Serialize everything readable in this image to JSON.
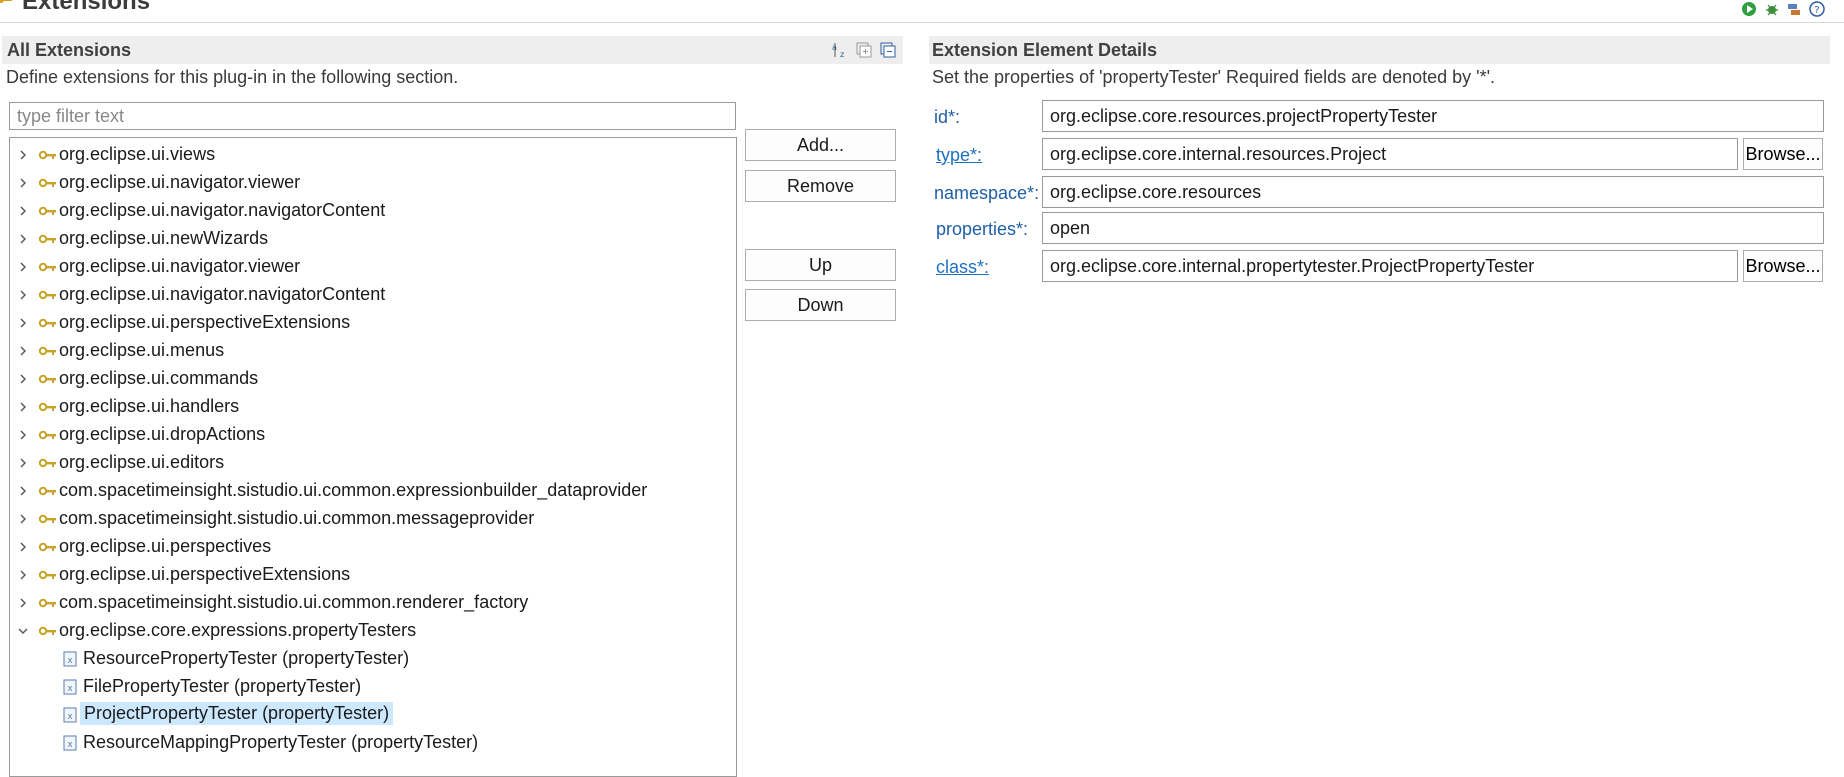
{
  "header": {
    "title": "Extensions",
    "icons": [
      "run-icon",
      "debug-icon",
      "plugin-icon",
      "help-icon"
    ]
  },
  "all_extensions": {
    "title": "All Extensions",
    "description": "Define extensions for this plug-in in the following section.",
    "toolbar_icons": [
      "sort-alpha-icon",
      "expand-all-icon",
      "collapse-all-icon"
    ],
    "filter_placeholder": "type filter text",
    "buttons": {
      "add": "Add...",
      "remove": "Remove",
      "up": "Up",
      "down": "Down"
    },
    "tree": [
      {
        "label": "org.eclipse.ui.views",
        "expanded": false
      },
      {
        "label": "org.eclipse.ui.navigator.viewer",
        "expanded": false
      },
      {
        "label": "org.eclipse.ui.navigator.navigatorContent",
        "expanded": false
      },
      {
        "label": "org.eclipse.ui.newWizards",
        "expanded": false
      },
      {
        "label": "org.eclipse.ui.navigator.viewer",
        "expanded": false
      },
      {
        "label": "org.eclipse.ui.navigator.navigatorContent",
        "expanded": false
      },
      {
        "label": "org.eclipse.ui.perspectiveExtensions",
        "expanded": false
      },
      {
        "label": "org.eclipse.ui.menus",
        "expanded": false
      },
      {
        "label": "org.eclipse.ui.commands",
        "expanded": false
      },
      {
        "label": "org.eclipse.ui.handlers",
        "expanded": false
      },
      {
        "label": "org.eclipse.ui.dropActions",
        "expanded": false
      },
      {
        "label": "org.eclipse.ui.editors",
        "expanded": false
      },
      {
        "label": "com.spacetimeinsight.sistudio.ui.common.expressionbuilder_dataprovider",
        "expanded": false
      },
      {
        "label": "com.spacetimeinsight.sistudio.ui.common.messageprovider",
        "expanded": false
      },
      {
        "label": "org.eclipse.ui.perspectives",
        "expanded": false
      },
      {
        "label": "org.eclipse.ui.perspectiveExtensions",
        "expanded": false
      },
      {
        "label": "com.spacetimeinsight.sistudio.ui.common.renderer_factory",
        "expanded": false
      },
      {
        "label": "org.eclipse.core.expressions.propertyTesters",
        "expanded": true
      }
    ],
    "children": [
      {
        "label": "ResourcePropertyTester (propertyTester)",
        "selected": false
      },
      {
        "label": "FilePropertyTester (propertyTester)",
        "selected": false
      },
      {
        "label": "ProjectPropertyTester (propertyTester)",
        "selected": true
      },
      {
        "label": "ResourceMappingPropertyTester (propertyTester)",
        "selected": false
      }
    ]
  },
  "details": {
    "title": "Extension Element Details",
    "description": "Set the properties of 'propertyTester' Required fields are denoted by '*'.",
    "browse_label": "Browse...",
    "fields": {
      "id": {
        "label": "id*:",
        "value": "org.eclipse.core.resources.projectPropertyTester"
      },
      "type": {
        "label": "type*:",
        "value": "org.eclipse.core.internal.resources.Project"
      },
      "namespace": {
        "label": "namespace*:",
        "value": "org.eclipse.core.resources"
      },
      "properties": {
        "label": "properties*:",
        "value": "open"
      },
      "class": {
        "label": "class*:",
        "value": "org.eclipse.core.internal.propertytester.ProjectPropertyTester"
      }
    }
  },
  "colors": {
    "selection": "#cce8ff",
    "link": "#1f6fc2",
    "section_bg": "#eeeeee",
    "key_icon": "#c9a227"
  }
}
